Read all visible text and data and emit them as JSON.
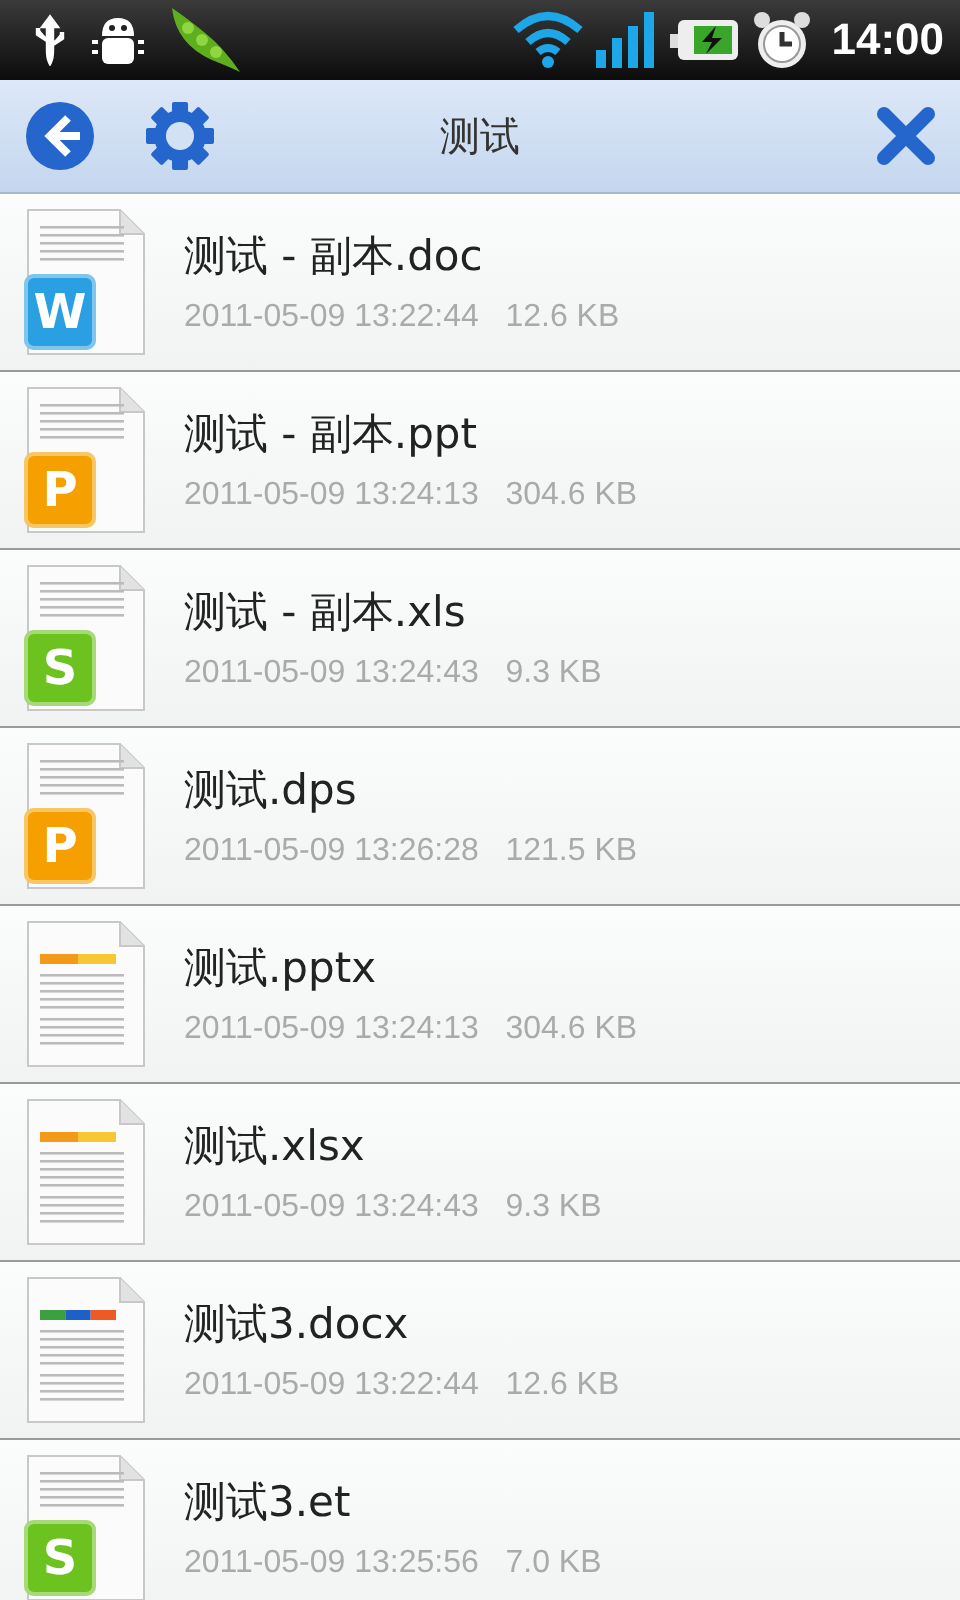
{
  "status_bar": {
    "time": "14:00"
  },
  "toolbar": {
    "title": "测试"
  },
  "files": [
    {
      "name": "测试 - 副本.doc",
      "meta": "2011-05-09 13:22:44   12.6 KB",
      "icon": {
        "kind": "badge",
        "letter": "W",
        "color": "#2a9fe2"
      }
    },
    {
      "name": "测试 - 副本.ppt",
      "meta": "2011-05-09 13:24:13   304.6 KB",
      "icon": {
        "kind": "badge",
        "letter": "P",
        "color": "#f5a000"
      }
    },
    {
      "name": "测试 - 副本.xls",
      "meta": "2011-05-09 13:24:43   9.3 KB",
      "icon": {
        "kind": "badge",
        "letter": "S",
        "color": "#6cc21e"
      }
    },
    {
      "name": "测试.dps",
      "meta": "2011-05-09 13:26:28   121.5 KB",
      "icon": {
        "kind": "badge",
        "letter": "P",
        "color": "#f5a000"
      }
    },
    {
      "name": "测试.pptx",
      "meta": "2011-05-09 13:24:13   304.6 KB",
      "icon": {
        "kind": "stripe",
        "stripes": [
          {
            "color": "#f39a1a"
          },
          {
            "color": "#f7c834"
          }
        ]
      }
    },
    {
      "name": "测试.xlsx",
      "meta": "2011-05-09 13:24:43   9.3 KB",
      "icon": {
        "kind": "stripe",
        "stripes": [
          {
            "color": "#f39a1a"
          },
          {
            "color": "#f7c834"
          }
        ]
      }
    },
    {
      "name": "测试3.docx",
      "meta": "2011-05-09 13:22:44   12.6 KB",
      "icon": {
        "kind": "stripe",
        "stripes": [
          {
            "color": "#3aa040"
          },
          {
            "color": "#1f5fc8"
          },
          {
            "color": "#ef5a24"
          }
        ]
      }
    },
    {
      "name": "测试3.et",
      "meta": "2011-05-09 13:25:56   7.0 KB",
      "icon": {
        "kind": "badge",
        "letter": "S",
        "color": "#6cc21e"
      }
    }
  ]
}
